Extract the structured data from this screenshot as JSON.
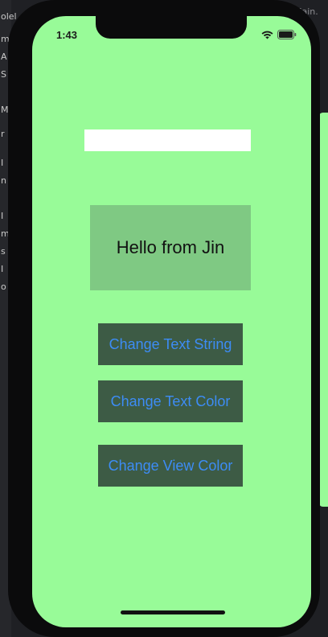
{
  "status_bar": {
    "time": "1:43"
  },
  "text_field": {
    "value": "",
    "placeholder": ""
  },
  "label": {
    "text": "Hello from Jin"
  },
  "buttons": [
    {
      "label": "Change Text String"
    },
    {
      "label": "Change Text Color"
    },
    {
      "label": "Change View Color"
    }
  ],
  "background_ide": {
    "left_strip_chars": [
      "olel",
      "m",
      "A",
      "S",
      "M",
      "r",
      "I",
      "n",
      "I",
      "m",
      "s",
      "I",
      "o"
    ],
    "top_right_tab": "Main."
  },
  "colors": {
    "screen_background": "#98fb98",
    "label_background": "#7fc983",
    "button_background": "#3d5b45",
    "button_text": "#3d8cf5",
    "text_field_background": "#ffffff"
  },
  "icons": {
    "wifi": "wifi-icon",
    "battery": "battery-icon"
  }
}
